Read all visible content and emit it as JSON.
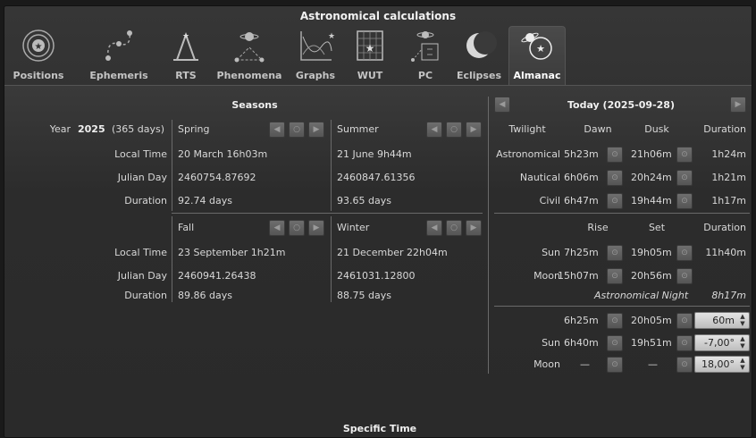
{
  "window": {
    "title": "Astronomical calculations"
  },
  "tabs": [
    {
      "label": "Positions",
      "icon": "positions-icon"
    },
    {
      "label": "Ephemeris",
      "icon": "ephemeris-icon"
    },
    {
      "label": "RTS",
      "icon": "rts-icon"
    },
    {
      "label": "Phenomena",
      "icon": "phenomena-icon"
    },
    {
      "label": "Graphs",
      "icon": "graphs-icon"
    },
    {
      "label": "WUT",
      "icon": "wut-icon"
    },
    {
      "label": "PC",
      "icon": "pc-icon"
    },
    {
      "label": "Eclipses",
      "icon": "eclipses-icon"
    },
    {
      "label": "Almanac",
      "icon": "almanac-icon",
      "active": true
    }
  ],
  "seasons": {
    "heading": "Seasons",
    "year_label": "Year",
    "year": "2025",
    "days": "(365 days)",
    "row_labels": {
      "local_time": "Local Time",
      "julian_day": "Julian Day",
      "duration": "Duration"
    },
    "spring": {
      "name": "Spring",
      "local_time": "20 March 16h03m",
      "julian_day": "2460754.87692",
      "duration": "92.74 days"
    },
    "summer": {
      "name": "Summer",
      "local_time": "21 June 9h44m",
      "julian_day": "2460847.61356",
      "duration": "93.65 days"
    },
    "fall": {
      "name": "Fall",
      "local_time": "23 September 1h21m",
      "julian_day": "2460941.26438",
      "duration": "89.86 days"
    },
    "winter": {
      "name": "Winter",
      "local_time": "21 December 22h04m",
      "julian_day": "2461031.12800",
      "duration": "88.75 days"
    }
  },
  "today": {
    "heading": "Today (2025-09-28)",
    "twilight_headers": {
      "twilight": "Twilight",
      "dawn": "Dawn",
      "dusk": "Dusk",
      "duration": "Duration"
    },
    "twilight_rows": [
      {
        "name": "Astronomical",
        "dawn": "5h23m",
        "dusk": "21h06m",
        "duration": "1h24m"
      },
      {
        "name": "Nautical",
        "dawn": "6h06m",
        "dusk": "20h24m",
        "duration": "1h21m"
      },
      {
        "name": "Civil",
        "dawn": "6h47m",
        "dusk": "19h44m",
        "duration": "1h17m"
      }
    ],
    "rise_headers": {
      "rise": "Rise",
      "set": "Set",
      "duration": "Duration"
    },
    "rise_rows": [
      {
        "name": "Sun",
        "rise": "7h25m",
        "set": "19h05m",
        "duration": "11h40m"
      },
      {
        "name": "Moon",
        "rise": "15h07m",
        "set": "20h56m",
        "duration": ""
      }
    ],
    "astro_night_label": "Astronomical Night",
    "astro_night_duration": "8h17m",
    "custom_rows": [
      {
        "name": "",
        "rise": "6h25m",
        "set": "20h05m",
        "value": "60m"
      },
      {
        "name": "Sun",
        "rise": "6h40m",
        "set": "19h51m",
        "value": "-7,00°"
      },
      {
        "name": "Moon",
        "rise": "—",
        "set": "—",
        "value": "18,00°"
      }
    ]
  },
  "footer": {
    "label": "Specific Time"
  },
  "colors": {
    "background": "#2b2b2b",
    "text": "#e0e0e0",
    "active_tab": "#444444"
  }
}
